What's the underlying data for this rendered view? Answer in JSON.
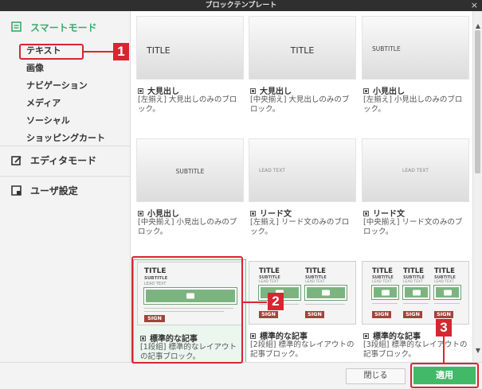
{
  "window": {
    "title": "ブロックテンプレート",
    "close": "×"
  },
  "sidebar": {
    "smart_mode": "スマートモード",
    "sub_items": [
      "テキスト",
      "画像",
      "ナビゲーション",
      "メディア",
      "ソーシャル",
      "ショッピングカート"
    ],
    "editor_mode": "エディタモード",
    "user_settings": "ユーザ設定"
  },
  "cards": [
    {
      "thumb": "TITLE",
      "name": "大見出し",
      "desc": "[左揃え] 大見出しのみのブロック。"
    },
    {
      "thumb": "TITLE",
      "name": "大見出し",
      "desc": "[中央揃え] 大見出しのみのブロック。"
    },
    {
      "thumb": "SUBTITLE",
      "name": "小見出し",
      "desc": "[左揃え] 小見出しのみのブロック。"
    },
    {
      "thumb": "SUBTITLE",
      "name": "小見出し",
      "desc": "[中央揃え] 小見出しのみのブロック。"
    },
    {
      "thumb": "LEAD TEXT",
      "name": "リード文",
      "desc": "[左揃え] リード文のみのブロック。"
    },
    {
      "thumb": "LEAD TEXT",
      "name": "リード文",
      "desc": "[中央揃え] リード文のみのブロック。"
    },
    {
      "name": "標準的な記事",
      "desc": "[1段組] 標準的なレイアウトの記事ブロック。"
    },
    {
      "name": "標準的な記事",
      "desc": "[2段組] 標準的なレイアウトの記事ブロック。"
    },
    {
      "name": "標準的な記事",
      "desc": "[3段組] 標準的なレイアウトの記事ブロック。"
    }
  ],
  "article_thumb": {
    "title": "TITLE",
    "subtitle": "SUBTITLE",
    "lead": "LEAD TEXT",
    "sign": "SIGN"
  },
  "footer": {
    "close": "閉じる",
    "apply": "適用"
  },
  "annotations": [
    "1",
    "2",
    "3"
  ],
  "colors": {
    "accent": "#41b969",
    "annotation": "#d72631",
    "sign": "#a1443b"
  }
}
